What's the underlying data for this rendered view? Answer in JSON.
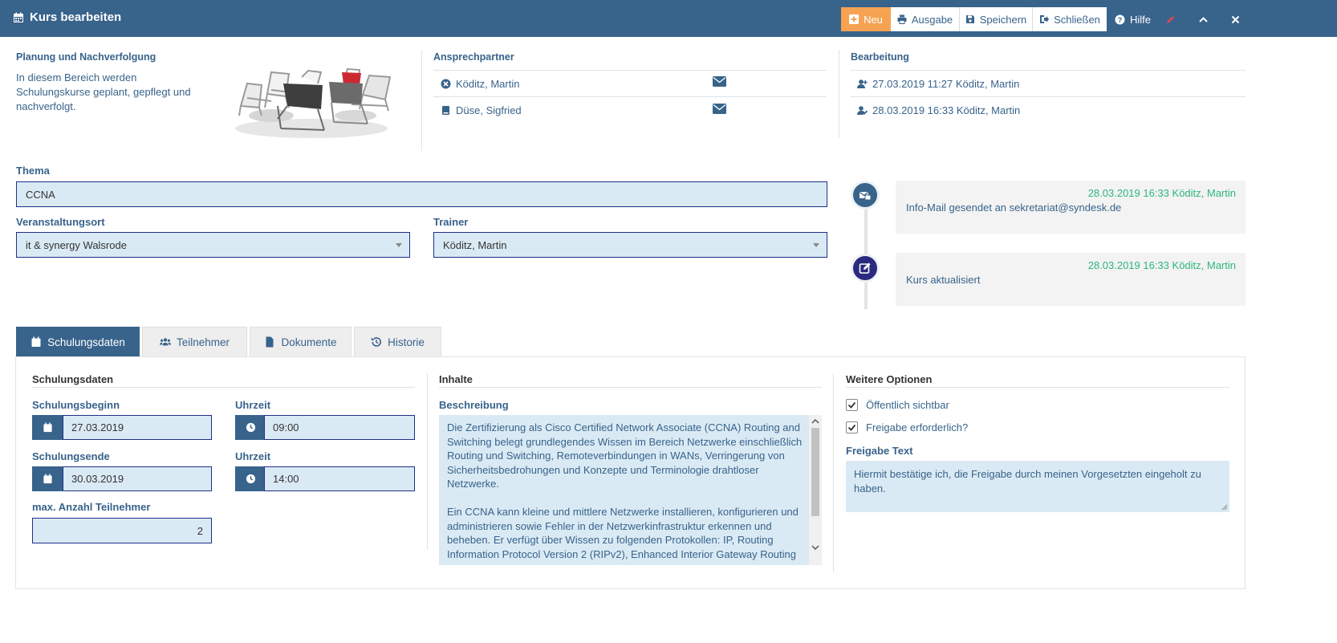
{
  "window": {
    "title": "Kurs bearbeiten"
  },
  "toolbar": {
    "neu": "Neu",
    "ausgabe": "Ausgabe",
    "speichern": "Speichern",
    "schliessen": "Schließen",
    "hilfe": "Hilfe"
  },
  "planung": {
    "heading": "Planung und Nachverfolgung",
    "text_lines": [
      "In diesem Bereich werden",
      "Schulungskurse geplant, gepflegt und",
      "nachverfolgt."
    ]
  },
  "ansprechpartner": {
    "heading": "Ansprechpartner",
    "contacts": [
      {
        "name": "Köditz, Martin",
        "icon": "user-circle-x-icon"
      },
      {
        "name": "Düse, Sigfried",
        "icon": "book-icon"
      }
    ]
  },
  "bearbeitung": {
    "heading": "Bearbeitung",
    "entries": [
      {
        "text": "27.03.2019 11:27 Köditz, Martin",
        "icon": "user-plus-icon"
      },
      {
        "text": "28.03.2019 16:33 Köditz, Martin",
        "icon": "user-edit-icon"
      }
    ]
  },
  "form": {
    "thema_label": "Thema",
    "thema_value": "CCNA",
    "ort_label": "Veranstaltungsort",
    "ort_value": "it & synergy Walsrode",
    "trainer_label": "Trainer",
    "trainer_value": "Köditz, Martin"
  },
  "timeline": [
    {
      "time": "28.03.2019 16:33 Köditz, Martin",
      "text": "Info-Mail gesendet an sekretariat@syndesk.de",
      "color": "#38638b",
      "icon": "mail-icon"
    },
    {
      "time": "28.03.2019 16:33 Köditz, Martin",
      "text": "Kurs aktualisiert",
      "color": "#2a2a7f",
      "icon": "edit-icon"
    }
  ],
  "tabs": [
    {
      "label": "Schulungsdaten",
      "active": true
    },
    {
      "label": "Teilnehmer",
      "active": false
    },
    {
      "label": "Dokumente",
      "active": false
    },
    {
      "label": "Historie",
      "active": false
    }
  ],
  "schulungsdaten": {
    "heading": "Schulungsdaten",
    "beginn_label": "Schulungsbeginn",
    "beginn_value": "27.03.2019",
    "beginn_zeit_label": "Uhrzeit",
    "beginn_zeit_value": "09:00",
    "ende_label": "Schulungsende",
    "ende_value": "30.03.2019",
    "ende_zeit_label": "Uhrzeit",
    "ende_zeit_value": "14:00",
    "max_label": "max. Anzahl Teilnehmer",
    "max_value": "2"
  },
  "inhalte": {
    "heading": "Inhalte",
    "beschreibung_label": "Beschreibung",
    "lines": [
      "Die Zertifizierung als Cisco Certified Network Associate (CCNA) Routing and",
      "Switching belegt grundlegendes Wissen im Bereich Netzwerke einschließlich",
      "Routing und Switching, Remoteverbindungen in WANs, Verringerung von",
      "Sicherheitsbedrohungen und Konzepte und Terminologie drahtloser",
      "Netzwerke.",
      "",
      "Ein CCNA kann kleine und mittlere Netzwerke installieren, konfigurieren und",
      "administrieren sowie Fehler in der Netzwerkinfrastruktur erkennen und",
      "beheben. Er verfügt über Wissen zu folgenden Protokollen: IP, Routing",
      "Information Protocol Version 2 (RIPv2), Enhanced Interior Gateway Routing"
    ]
  },
  "optionen": {
    "heading": "Weitere Optionen",
    "oeffentlich": {
      "label": "Öffentlich sichtbar",
      "checked": true
    },
    "freigabe": {
      "label": "Freigabe erforderlich?",
      "checked": true
    },
    "freigabe_text_label": "Freigabe Text",
    "freigabe_text_lines": [
      "Hiermit bestätige ich, die Freigabe durch meinen Vorgesetzten eingeholt zu",
      "haben."
    ]
  },
  "colors": {
    "primary": "#38638b",
    "accent": "#f5a352",
    "field": "#daeaf4",
    "success": "#2db67c"
  }
}
